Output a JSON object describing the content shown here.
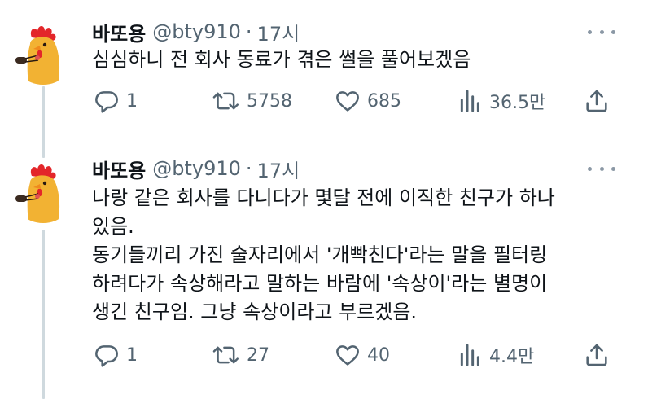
{
  "tweets": [
    {
      "name": "바또용",
      "handle": "@bty910",
      "separator": "·",
      "time": "17시",
      "lines": [
        "심심하니 전 회사 동료가 겪은 썰을 풀어보겠음"
      ],
      "actions": {
        "replies": "1",
        "retweets": "5758",
        "likes": "685",
        "views": "36.5만"
      }
    },
    {
      "name": "바또용",
      "handle": "@bty910",
      "separator": "·",
      "time": "17시",
      "lines": [
        "나랑 같은 회사를 다니다가 몇달 전에 이직한 친구가 하나",
        "있음.",
        "동기들끼리 가진 술자리에서 '개빡친다'라는 말을 필터링",
        "하려다가 속상해라고 말하는 바람에 '속상이'라는 별명이",
        "생긴 친구임. 그냥 속상이라고 부르겠음."
      ],
      "actions": {
        "replies": "1",
        "retweets": "27",
        "likes": "40",
        "views": "4.4만"
      }
    }
  ],
  "icons": {
    "reply": "reply-icon",
    "retweet": "retweet-icon",
    "like": "like-icon",
    "views": "views-icon",
    "share": "share-icon",
    "more": "more-icon",
    "avatar": "rooster-avatar"
  },
  "colors": {
    "text": "#0f1419",
    "secondary": "#536471",
    "thread_line": "#cfd9de",
    "icon": "#536471"
  }
}
